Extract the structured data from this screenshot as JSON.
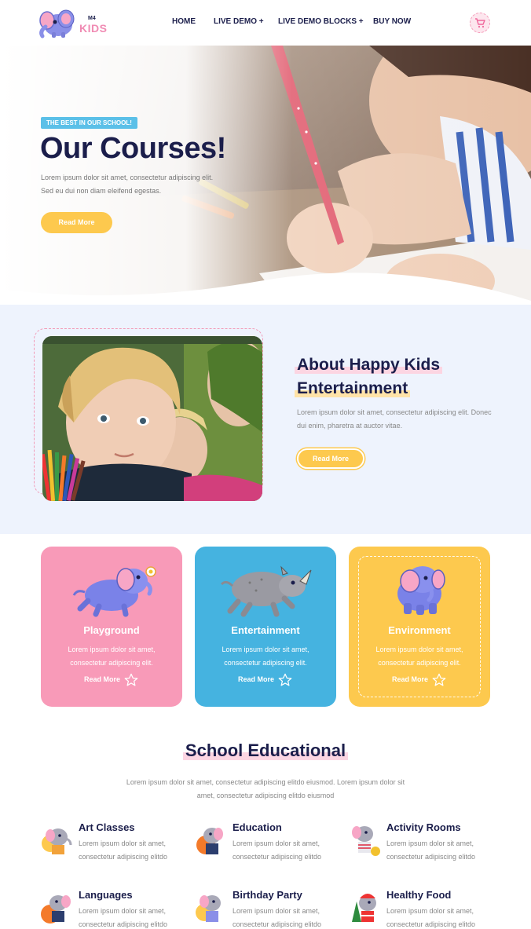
{
  "header": {
    "logo_small": "M4",
    "logo_text": "KIDS",
    "nav": [
      "HOME",
      "LIVE DEMO +",
      "LIVE DEMO BLOCKS +",
      "BUY NOW"
    ]
  },
  "hero": {
    "badge": "THE BEST IN OUR SCHOOL!",
    "title": "Our Courses!",
    "text_line1": "Lorem ipsum dolor sit amet, consectetur adipiscing elit.",
    "text_line2": "Sed eu dui non diam eleifend egestas.",
    "button": "Read More"
  },
  "about": {
    "title_line1": "About Happy Kids",
    "title_line2": "Entertainment",
    "text": "Lorem ipsum dolor sit amet, consectetur adipiscing elit. Donec dui enim, pharetra at auctor vitae.",
    "button": "Read More"
  },
  "cards": [
    {
      "title": "Playground",
      "text_line1": "Lorem ipsum dolor sit amet,",
      "text_line2": "consectetur adipiscing elit.",
      "link": "Read More",
      "color": "#f89ab8"
    },
    {
      "title": "Entertainment",
      "text_line1": "Lorem ipsum dolor sit amet,",
      "text_line2": "consectetur adipiscing elit.",
      "link": "Read More",
      "color": "#45b3e0"
    },
    {
      "title": "Environment",
      "text_line1": "Lorem ipsum dolor sit amet,",
      "text_line2": "consectetur adipiscing elit.",
      "link": "Read More",
      "color": "#fdc94e"
    }
  ],
  "educational": {
    "title": "School Educational",
    "subtitle_line1": "Lorem ipsum dolor sit amet, consectetur adipiscing elitdo eiusmod. Lorem ipsum dolor sit",
    "subtitle_line2": "amet, consectetur adipiscing elitdo eiusmod",
    "features": [
      {
        "title": "Art Classes",
        "line1": "Lorem ipsum dolor sit amet,",
        "line2": "consectetur adipiscing elitdo"
      },
      {
        "title": "Education",
        "line1": "Lorem ipsum dolor sit amet,",
        "line2": "consectetur adipiscing elitdo"
      },
      {
        "title": "Activity Rooms",
        "line1": "Lorem ipsum dolor sit amet,",
        "line2": "consectetur adipiscing elitdo"
      },
      {
        "title": "Languages",
        "line1": "Lorem ipsum dolor sit amet,",
        "line2": "consectetur adipiscing elitdo"
      },
      {
        "title": "Birthday Party",
        "line1": "Lorem ipsum dolor sit amet,",
        "line2": "consectetur adipiscing elitdo"
      },
      {
        "title": "Healthy Food",
        "line1": "Lorem ipsum dolor sit amet,",
        "line2": "consectetur adipiscing elitdo"
      }
    ]
  },
  "colors": {
    "navy": "#1b1e4b",
    "pink": "#f89ab8",
    "blue": "#45b3e0",
    "yellow": "#fdc94e",
    "badge_blue": "#5bc0e8",
    "about_bg": "#eef3fd"
  },
  "icons": [
    "elephant-logo-icon",
    "cart-icon",
    "star-icon",
    "elephant-mascot-icon",
    "rhino-mascot-icon"
  ]
}
